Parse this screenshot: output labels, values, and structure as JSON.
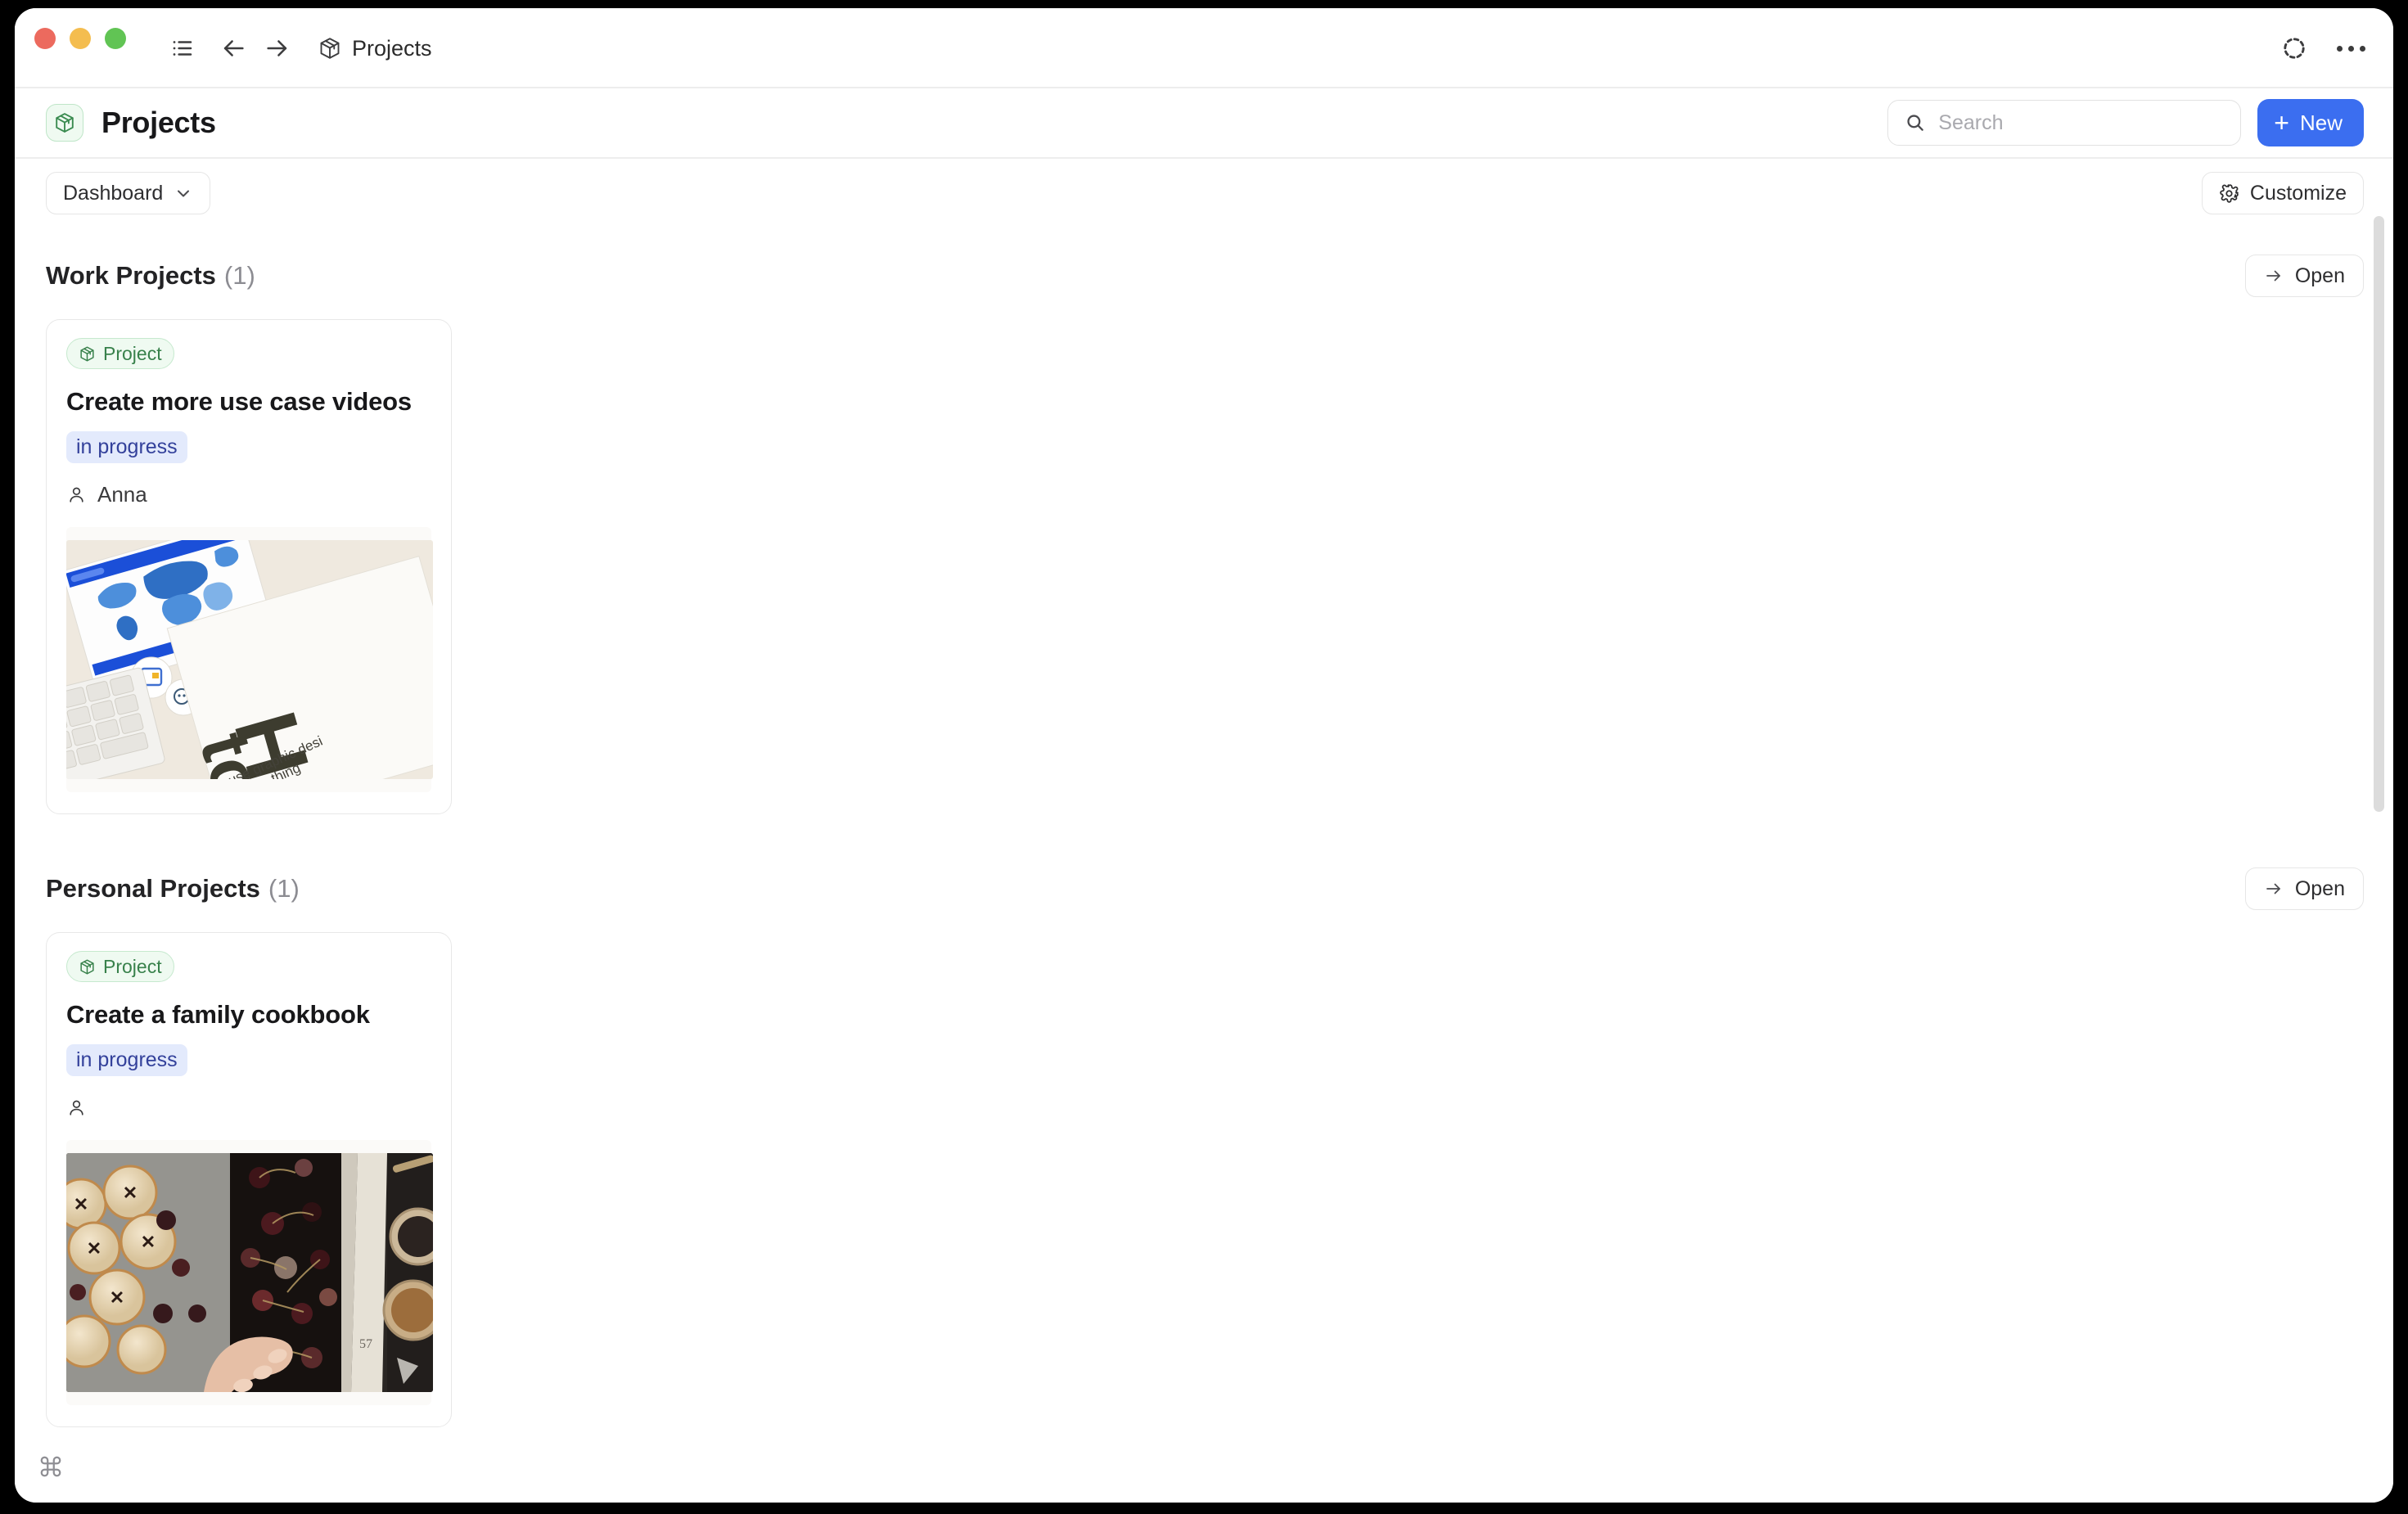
{
  "window": {
    "traffic_lights": [
      "close",
      "minimize",
      "maximize"
    ]
  },
  "titlebar": {
    "sidebar_toggle_icon": "list-icon",
    "back_icon": "arrow-left-icon",
    "forward_icon": "arrow-right-icon",
    "breadcrumb_icon": "package-icon",
    "breadcrumb_label": "Projects",
    "status_icon": "dashed-circle-icon",
    "more_menu_label": "..."
  },
  "page_header": {
    "app_icon": "package-icon",
    "title": "Projects",
    "search": {
      "icon": "search-icon",
      "placeholder": "Search",
      "value": ""
    },
    "new_button": {
      "icon": "plus-icon",
      "label": "New"
    }
  },
  "toolbar": {
    "view_selector": {
      "label": "Dashboard",
      "icon": "chevron-down-icon"
    },
    "customize_button": {
      "icon": "gear-icon",
      "label": "Customize"
    }
  },
  "sections": [
    {
      "title": "Work Projects",
      "count": "(1)",
      "open_button": {
        "icon": "arrow-right-icon",
        "label": "Open"
      },
      "cards": [
        {
          "type_badge": {
            "icon": "package-icon",
            "label": "Project"
          },
          "title": "Create more use case videos",
          "status": "in progress",
          "assignee_icon": "person-icon",
          "assignee": "Anna",
          "thumbnail": "desk-keyboard-how-to-book-photo"
        }
      ]
    },
    {
      "title": "Personal Projects",
      "count": "(1)",
      "open_button": {
        "icon": "arrow-right-icon",
        "label": "Open"
      },
      "cards": [
        {
          "type_badge": {
            "icon": "package-icon",
            "label": "Project"
          },
          "title": "Create a family cookbook",
          "status": "in progress",
          "assignee_icon": "person-icon",
          "assignee": "",
          "thumbnail": "open-cookbook-cherry-tarts-photo"
        }
      ]
    }
  ],
  "footer": {
    "command_icon": "command-key-icon"
  },
  "colors": {
    "accent_blue": "#3b6ef0",
    "badge_green_text": "#38814b",
    "badge_green_bg": "#effaf1",
    "status_blue_text": "#33419b",
    "status_blue_bg": "#e3eafc"
  }
}
